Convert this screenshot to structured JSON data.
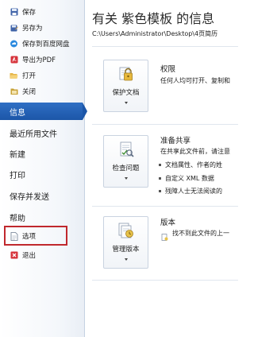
{
  "nav": {
    "commands": [
      {
        "label": "保存",
        "icon": "save-icon",
        "color": "#3f63a8"
      },
      {
        "label": "另存为",
        "icon": "save-as-icon",
        "color": "#3f63a8"
      },
      {
        "label": "保存到百度网盘",
        "icon": "cloud-save-icon",
        "color": "#2c8adf"
      },
      {
        "label": "导出为PDF",
        "icon": "pdf-icon",
        "color": "#d6333b"
      },
      {
        "label": "打开",
        "icon": "folder-open-icon",
        "color": "#e6b64a"
      },
      {
        "label": "关闭",
        "icon": "close-document-icon",
        "color": "#c8a238"
      }
    ],
    "tabs": [
      {
        "label": "信息",
        "active": true
      },
      {
        "label": "最近所用文件",
        "active": false
      },
      {
        "label": "新建",
        "active": false
      },
      {
        "label": "打印",
        "active": false
      },
      {
        "label": "保存并发送",
        "active": false
      },
      {
        "label": "帮助",
        "active": false
      }
    ],
    "bottom_commands": [
      {
        "label": "选项",
        "icon": "options-icon",
        "highlighted": true
      },
      {
        "label": "退出",
        "icon": "exit-icon",
        "color": "#d6333b"
      }
    ],
    "active_color": "#2264b8",
    "highlight_color": "#c0282d"
  },
  "main": {
    "title": "有关 紫色模板 的信息",
    "path": "C:\\Users\\Administrator\\Desktop\\4页简历",
    "sections": {
      "permissions": {
        "button_label": "保护文档",
        "button_icon": "lock-key-icon",
        "heading": "权限",
        "desc": "任何人均可打开、复制和"
      },
      "prepare": {
        "button_label": "检查问题",
        "button_icon": "inspect-document-icon",
        "heading": "准备共享",
        "desc": "在共享此文件前，请注意",
        "bullets": [
          "文档属性、作者的姓",
          "自定义 XML 数据",
          "残障人士无法阅读的"
        ]
      },
      "versions": {
        "button_label": "管理版本",
        "button_icon": "versions-icon",
        "heading": "版本",
        "desc": "找不到此文件的上一"
      }
    }
  }
}
